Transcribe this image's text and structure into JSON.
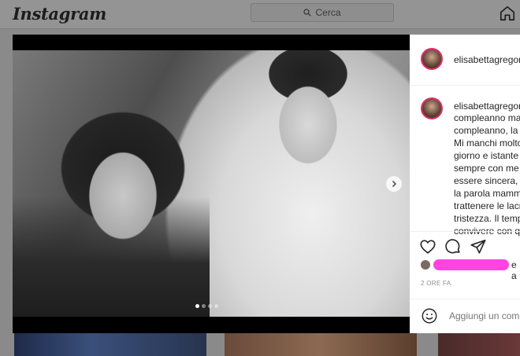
{
  "topbar": {
    "logo": "Instagram",
    "search_placeholder": "Cerca"
  },
  "post": {
    "username": "elisabettagregoraci",
    "caption_lines": [
      "compleanno ma",
      "compleanno, la t",
      "Mi manchi molto",
      "giorno e istante",
      "sempre con me",
      "essere sincera, t",
      "la parola mamm",
      "trattenere le lacr",
      "tristezza. Il temp",
      "convivere con qu"
    ],
    "likes_suffix": "e a",
    "timestamp": "2 ORE FA",
    "comment_placeholder": "Aggiungi un commento..."
  }
}
